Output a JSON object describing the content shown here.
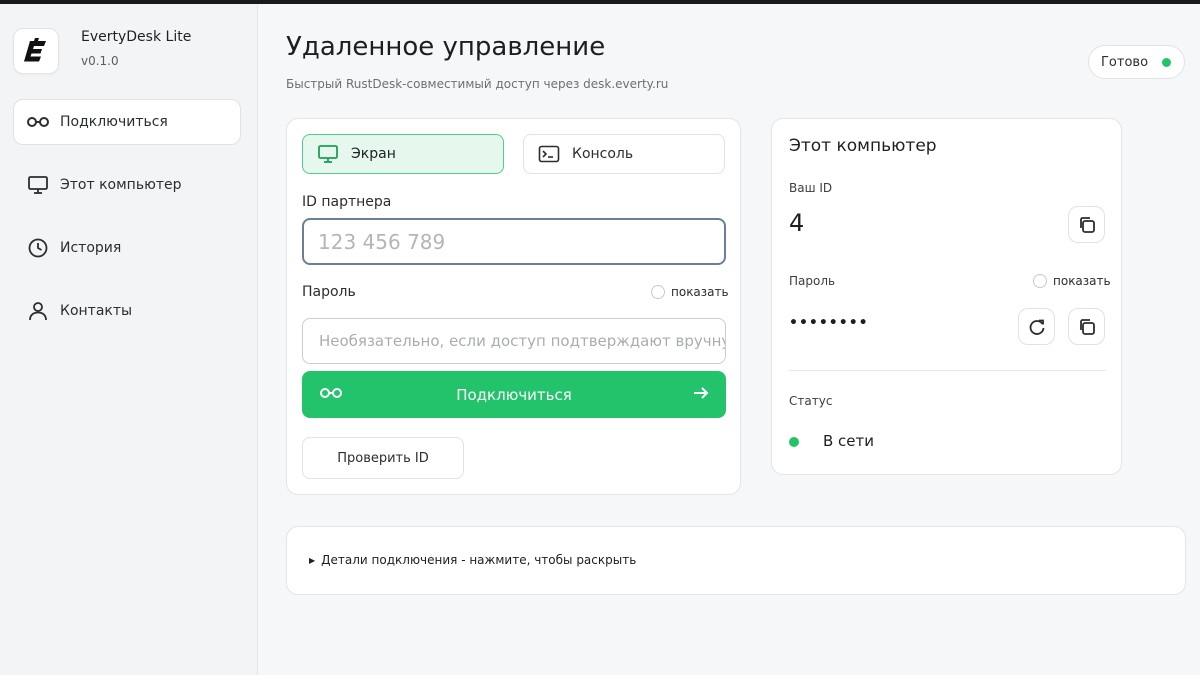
{
  "app": {
    "name": "EvertyDesk Lite",
    "version": "v0.1.0",
    "logo_letter": "E"
  },
  "sidebar": {
    "items": [
      {
        "label": "Подключиться",
        "icon": "link-icon",
        "active": true
      },
      {
        "label": "Этот компьютер",
        "icon": "monitor-icon",
        "active": false
      },
      {
        "label": "История",
        "icon": "clock-icon",
        "active": false
      },
      {
        "label": "Контакты",
        "icon": "user-icon",
        "active": false
      }
    ]
  },
  "header": {
    "title": "Удаленное управление",
    "subtitle": "Быстрый RustDesk-совместимый доступ через desk.everty.ru",
    "status": "Готово",
    "status_color": "#22c36a"
  },
  "connect": {
    "modes": [
      {
        "label": "Экран",
        "icon": "monitor-icon",
        "selected": true
      },
      {
        "label": "Консоль",
        "icon": "terminal-icon",
        "selected": false
      }
    ],
    "partner_label": "ID партнера",
    "partner_placeholder": "123 456 789",
    "password_label": "Пароль",
    "show_label": "показать",
    "password_placeholder": "Необязательно, если доступ подтверждают вручную",
    "connect_label": "Подключиться",
    "verify_label": "Проверить ID"
  },
  "computer": {
    "title": "Этот компьютер",
    "id_label": "Ваш ID",
    "id_value": "4",
    "password_label": "Пароль",
    "show_label": "показать",
    "password_value": "••••••••",
    "status_label": "Статус",
    "status_value": "В сети"
  },
  "details": {
    "label": "Детали подключения - нажмите, чтобы раскрыть"
  },
  "colors": {
    "accent": "#22c36a",
    "accent_soft": "#e6f7ee",
    "input_border": "#6a7f9a"
  }
}
